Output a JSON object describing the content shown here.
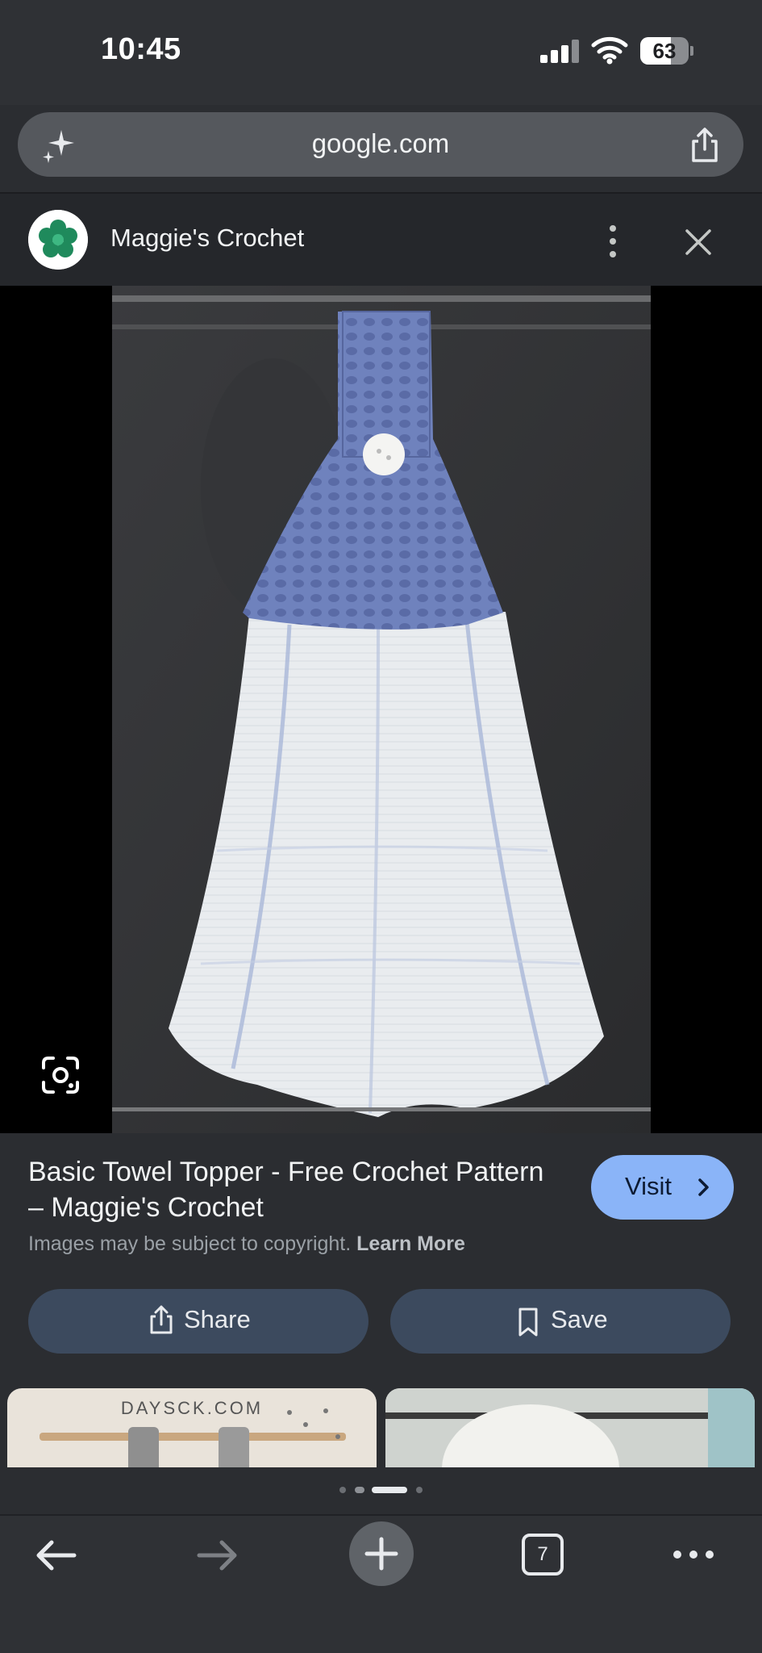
{
  "status_bar": {
    "time": "10:45",
    "battery": "63",
    "battery_level": 0.63
  },
  "url_bar": {
    "url": "google.com"
  },
  "source": {
    "name": "Maggie's Crochet"
  },
  "result": {
    "title": "Basic Towel Topper - Free Crochet Pattern – Maggie's Crochet",
    "visit_label": "Visit",
    "copyright_text": "Images may be subject to copyright.",
    "learn_more": "Learn More",
    "share_label": "Share",
    "save_label": "Save"
  },
  "related": {
    "thumb1_text": "DAYSCK.COM"
  },
  "bottom_nav": {
    "tab_count": "7"
  },
  "colors": {
    "accent": "#8ab4f8",
    "pill": "#3c4a5e",
    "towel_blue": "#6f82bd"
  }
}
